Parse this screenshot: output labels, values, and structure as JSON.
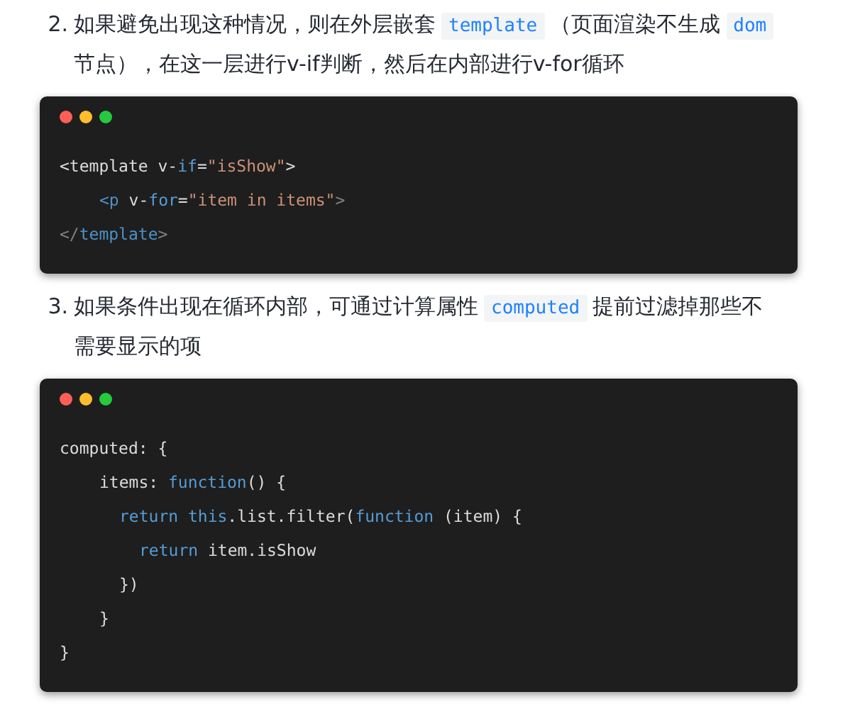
{
  "items": [
    {
      "number": "2.",
      "segments": [
        {
          "kind": "text",
          "text": "如果避免出现这种情况，则在外层嵌套"
        },
        {
          "kind": "code",
          "text": "template"
        },
        {
          "kind": "text",
          "text": "（页面渲染不生成"
        },
        {
          "kind": "code",
          "text": "dom"
        },
        {
          "kind": "text",
          "text": "节点），在这一层进行v-if判断，然后在内部进行v-for循环"
        }
      ],
      "code_block": {
        "lines": [
          {
            "tokens": [
              {
                "kind": "plain",
                "text": "<template v-"
              },
              {
                "kind": "keyword",
                "text": "if"
              },
              {
                "kind": "plain",
                "text": "="
              },
              {
                "kind": "string",
                "text": "\"isShow\""
              },
              {
                "kind": "plain",
                "text": ">"
              }
            ],
            "children": [
              {
                "tokens": [
                  {
                    "kind": "tag",
                    "text": "<p"
                  },
                  {
                    "kind": "plain",
                    "text": " v-"
                  },
                  {
                    "kind": "keyword",
                    "text": "for"
                  },
                  {
                    "kind": "plain",
                    "text": "="
                  },
                  {
                    "kind": "string",
                    "text": "\"item in items\""
                  },
                  {
                    "kind": "punct",
                    "text": ">"
                  }
                ]
              }
            ]
          },
          {
            "tokens": [
              {
                "kind": "punct",
                "text": "</"
              },
              {
                "kind": "tag",
                "text": "template"
              },
              {
                "kind": "punct",
                "text": ">"
              }
            ]
          }
        ]
      }
    },
    {
      "number": "3.",
      "segments": [
        {
          "kind": "text",
          "text": "如果条件出现在循环内部，可通过计算属性"
        },
        {
          "kind": "code",
          "text": "computed"
        },
        {
          "kind": "text",
          "text": "提前过滤掉那些不需要显示的项"
        }
      ],
      "code_block": {
        "lines": [
          {
            "tokens": [
              {
                "kind": "plain",
                "text": "computed: {"
              }
            ],
            "children": [
              {
                "tokens": [
                  {
                    "kind": "plain",
                    "text": "items: "
                  },
                  {
                    "kind": "keyword",
                    "text": "function"
                  },
                  {
                    "kind": "plain",
                    "text": "() {"
                  }
                ],
                "children": [
                  {
                    "tokens": [
                      {
                        "kind": "keyword",
                        "text": "return "
                      },
                      {
                        "kind": "keyword",
                        "text": "this"
                      },
                      {
                        "kind": "plain",
                        "text": ".list.filter("
                      },
                      {
                        "kind": "keyword",
                        "text": "function"
                      },
                      {
                        "kind": "plain",
                        "text": " (item) {"
                      }
                    ],
                    "children": [
                      {
                        "tokens": [
                          {
                            "kind": "keyword",
                            "text": "return "
                          },
                          {
                            "kind": "plain",
                            "text": "item.isShow"
                          }
                        ]
                      }
                    ]
                  },
                  {
                    "tokens": [
                      {
                        "kind": "plain",
                        "text": "})"
                      }
                    ]
                  }
                ]
              },
              {
                "tokens": [
                  {
                    "kind": "plain",
                    "text": "}"
                  }
                ]
              }
            ]
          },
          {
            "tokens": [
              {
                "kind": "plain",
                "text": "}"
              }
            ]
          }
        ]
      }
    }
  ]
}
